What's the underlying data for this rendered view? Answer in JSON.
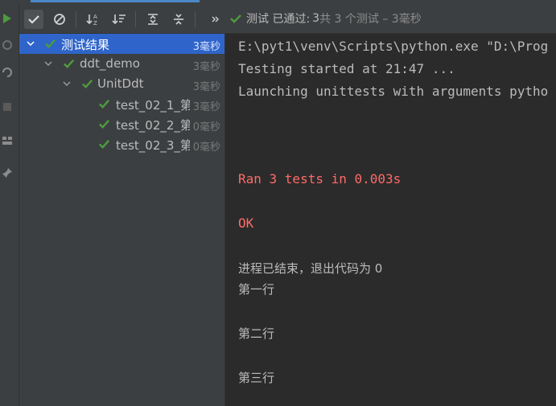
{
  "toolbar": {
    "status_prefix": "测试 已通过:",
    "status_count": "3",
    "status_suffix": "共 3 个测试 – 3毫秒"
  },
  "tree": {
    "items": [
      {
        "label": "测试结果",
        "time": "3毫秒"
      },
      {
        "label": "ddt_demo",
        "time": "3毫秒"
      },
      {
        "label": "UnitDdt",
        "time": "3毫秒"
      },
      {
        "label": "test_02_1_第",
        "time": "3毫秒"
      },
      {
        "label": "test_02_2_第",
        "time": "0毫秒"
      },
      {
        "label": "test_02_3_第",
        "time": "0毫秒"
      }
    ]
  },
  "console": {
    "lines": [
      "E:\\pyt1\\venv\\Scripts\\python.exe \"D:\\Prog",
      "Testing started at 21:47 ...",
      "Launching unittests with arguments pytho",
      "Ran 3 tests in 0.003s",
      "OK",
      "进程已结束，退出代码为 0",
      "第一行",
      "第二行",
      "第三行"
    ]
  },
  "colors": {
    "pass_green": "#4e9a3f",
    "error_red": "#ff6b68",
    "selection_blue": "#2f65ca"
  }
}
